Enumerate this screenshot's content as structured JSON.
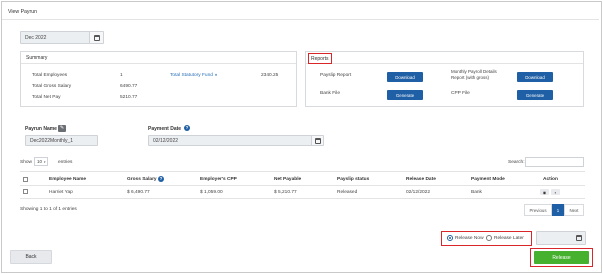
{
  "page": {
    "title": "View Payrun"
  },
  "period": {
    "value": "Dec 2022"
  },
  "summary": {
    "title": "Summary",
    "total_employees_label": "Total Employees",
    "total_employees_value": "1",
    "total_gross_label": "Total Gross Salary",
    "total_gross_value": "6490.77",
    "total_net_label": "Total Net Pay",
    "total_net_value": "5210.77",
    "statutory_label": "Total Statutory Fund",
    "statutory_value": "2340.25"
  },
  "reports": {
    "title": "Reports",
    "payslip_label": "Payslip Report",
    "payslip_btn": "Download",
    "bank_label": "Bank File",
    "bank_btn": "Generate",
    "monthly_label_1": "Monthly Payroll Details",
    "monthly_label_2": "Report (with gross)",
    "monthly_btn": "Download",
    "cpp_label": "CPP File",
    "cpp_btn": "Generate"
  },
  "payrun": {
    "name_label": "Payrun Name",
    "name_value": "Dec2022Monthly_1",
    "date_label": "Payment Date",
    "date_value": "02/12/2022"
  },
  "table_controls": {
    "show_label": "Show",
    "show_value": "10",
    "entries_label": "entries",
    "search_label": "Search:"
  },
  "table": {
    "headers": [
      "Employee Name",
      "Gross Salary",
      "Employer's CPP",
      "Net Payable",
      "Payslip status",
      "Release Date",
      "Payment Mode",
      "Action"
    ],
    "rows": [
      [
        "Harriet Yap",
        "$ 6,490.77",
        "$ 1,059.00",
        "$ 5,210.77",
        "Released",
        "02/12/2022",
        "Bank"
      ]
    ],
    "info": "Showing 1 to 1 of 1 entries",
    "prev": "Previous",
    "page": "1",
    "next": "Next"
  },
  "release_options": {
    "now": "Release Now",
    "later": "Release Later"
  },
  "footer": {
    "back": "Back",
    "release": "Release"
  },
  "colors": {
    "primary": "#1f5fa5",
    "release": "#45b12e",
    "highlight": "#d9262b"
  }
}
